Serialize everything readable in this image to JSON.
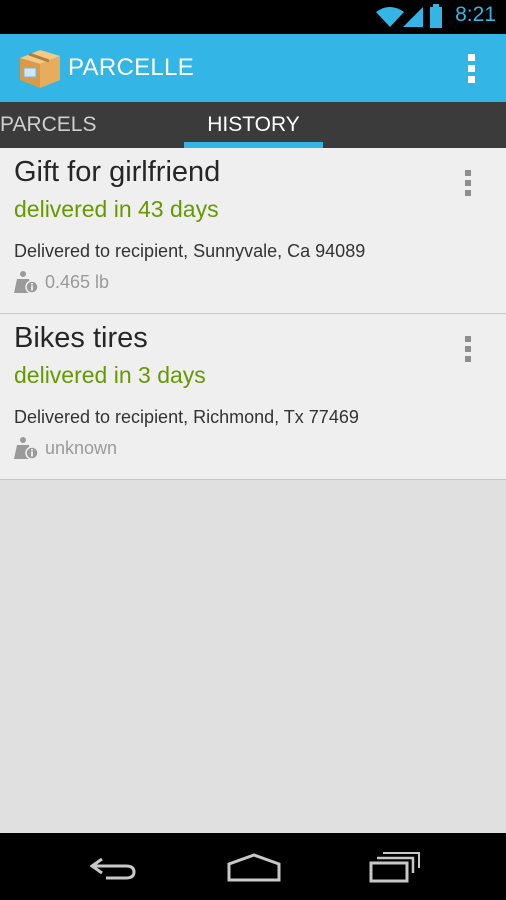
{
  "status_bar": {
    "time": "8:21"
  },
  "app": {
    "title": "PARCELLE"
  },
  "tabs": [
    {
      "label": "PARCELS",
      "active": false
    },
    {
      "label": "HISTORY",
      "active": true
    }
  ],
  "parcels": [
    {
      "title": "Gift for girlfriend",
      "status": "delivered in 43 days",
      "location": "Delivered to recipient, Sunnyvale, Ca 94089",
      "weight": "0.465 lb"
    },
    {
      "title": "Bikes tires",
      "status": "delivered in 3 days",
      "location": "Delivered to recipient, Richmond, Tx 77469",
      "weight": "unknown"
    }
  ],
  "colors": {
    "accent": "#33b5e5",
    "status_green": "#669900",
    "tab_bar": "#3b3b3b"
  },
  "icons": [
    "wifi-icon",
    "signal-icon",
    "battery-icon",
    "parcel-box-icon",
    "overflow-menu-icon",
    "weight-info-icon",
    "back-icon",
    "home-icon",
    "recent-apps-icon"
  ]
}
